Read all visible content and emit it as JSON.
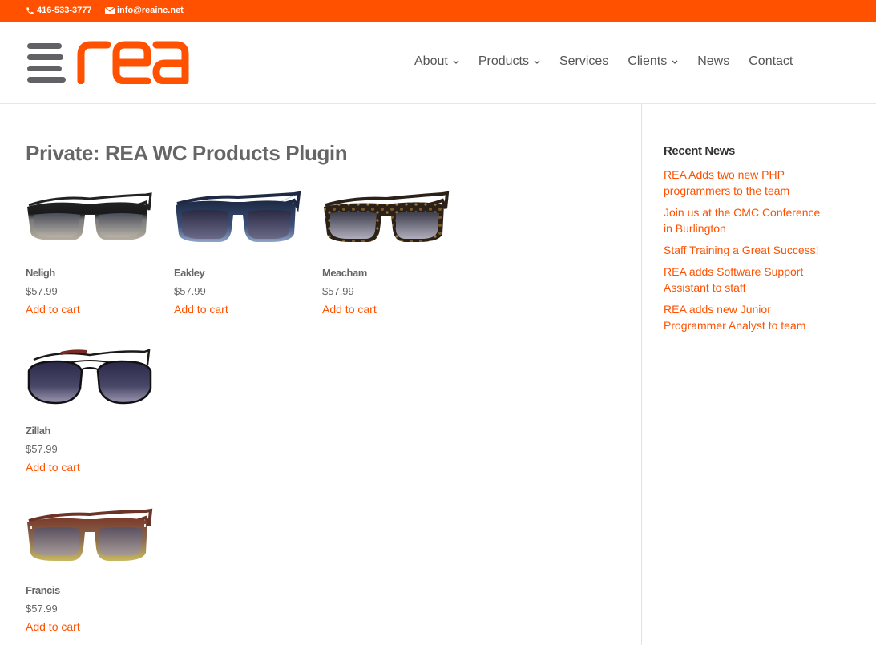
{
  "topbar": {
    "phone": "416-533-3777",
    "email": "info@reainc.net",
    "phone_icon": "phone-icon",
    "email_icon": "envelope-icon"
  },
  "logo": {
    "text": "rea"
  },
  "nav": {
    "items": [
      {
        "label": "About",
        "dropdown": true
      },
      {
        "label": "Products",
        "dropdown": true
      },
      {
        "label": "Services",
        "dropdown": false
      },
      {
        "label": "Clients",
        "dropdown": true
      },
      {
        "label": "News",
        "dropdown": false
      },
      {
        "label": "Contact",
        "dropdown": false
      }
    ]
  },
  "page": {
    "title": "Private: REA WC Products Plugin"
  },
  "products": [
    {
      "name": "Neligh",
      "price": "$57.99",
      "cart_label": "Add to cart",
      "frame": "black-grey"
    },
    {
      "name": "Eakley",
      "price": "$57.99",
      "cart_label": "Add to cart",
      "frame": "navy-blue"
    },
    {
      "name": "Meacham",
      "price": "$57.99",
      "cart_label": "Add to cart",
      "frame": "tortoise"
    },
    {
      "name": "Zillah",
      "price": "$57.99",
      "cart_label": "Add to cart",
      "frame": "black-aviator"
    },
    {
      "name": "Francis",
      "price": "$57.99",
      "cart_label": "Add to cart",
      "frame": "brown-yellow"
    }
  ],
  "sidebar": {
    "title": "Recent News",
    "items": [
      "REA Adds two new PHP programmers to the team",
      "Join us at the CMC Conference in Burlington",
      "Staff Training a Great Success!",
      "REA adds Software Support Assistant to staff",
      "REA adds new Junior Programmer Analyst to team"
    ]
  },
  "colors": {
    "accent": "#ff5100",
    "logo_bars": "#616166",
    "text": "#666666"
  }
}
